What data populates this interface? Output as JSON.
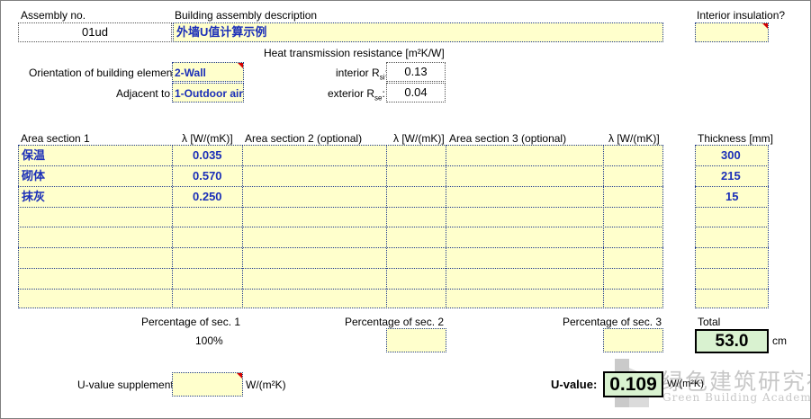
{
  "labels": {
    "assembly_no": "Assembly no.",
    "building_desc": "Building assembly description",
    "interior_insulation": "Interior insulation?",
    "heat_transmission": "Heat transmission resistance  [m²K/W]",
    "orientation": "Orientation of building element",
    "adjacent_to": "Adjacent to",
    "interior_r": "interior R",
    "interior_r_sub": "si",
    "exterior_r": "exterior R",
    "exterior_r_sub": "se",
    "area_section_1": "Area section 1",
    "area_section_2": "Area section 2 (optional)",
    "area_section_3": "Area section 3 (optional)",
    "lambda": "λ [W/(mK)]",
    "thickness": "Thickness [mm]",
    "pct_sec1": "Percentage of sec. 1",
    "pct_sec2": "Percentage of sec. 2",
    "pct_sec3": "Percentage of sec. 3",
    "total": "Total",
    "cm": "cm",
    "u_supplement": "U-value supplement",
    "u_supp_unit": "W/(m²K)",
    "u_value": "U-value:",
    "u_unit": "W/(m²K)"
  },
  "values": {
    "assembly_no": "01ud",
    "description": "外墙U值计算示例",
    "interior_insulation": "",
    "orientation": "2-Wall",
    "adjacent": "1-Outdoor air",
    "interior_r": "0.13",
    "exterior_r": "0.04",
    "pct_sec1": "100%",
    "total_cm": "53.0",
    "u_value": "0.109"
  },
  "rows": [
    {
      "name": "保温",
      "lambda": "0.035",
      "thickness": "300"
    },
    {
      "name": "砌体",
      "lambda": "0.570",
      "thickness": "215"
    },
    {
      "name": "抹灰",
      "lambda": "0.250",
      "thickness": "15"
    }
  ],
  "watermark": {
    "cn": "绿色建筑研究社",
    "en": "Green Building Academy"
  },
  "colors": {
    "input_fill": "#ffffcc",
    "input_text": "#1b2fb8",
    "result_fill": "#d9f2d0",
    "comment_marker": "#d40000"
  }
}
